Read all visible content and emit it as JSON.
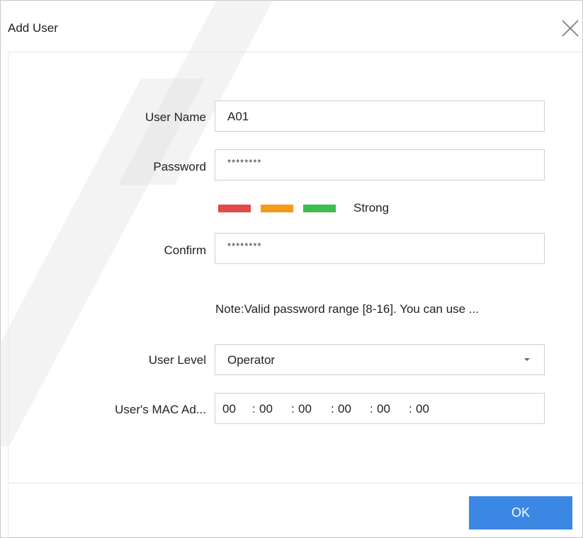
{
  "dialog": {
    "title": "Add User",
    "close_icon": "close-icon"
  },
  "form": {
    "user_name": {
      "label": "User Name",
      "value": "A01"
    },
    "password": {
      "label": "Password",
      "value": "********"
    },
    "strength": {
      "text": "Strong",
      "bars": [
        {
          "color": "#e24a4a"
        },
        {
          "color": "#f49b19"
        },
        {
          "color": "#3ebd4f"
        }
      ]
    },
    "confirm": {
      "label": "Confirm",
      "value": "********"
    },
    "note": "Note:Valid password range [8-16]. You can use ...",
    "user_level": {
      "label": "User Level",
      "value": "Operator",
      "caret_icon": "caret-down-icon"
    },
    "mac": {
      "label": "User's MAC Ad...",
      "segments": [
        "00",
        ":",
        "00",
        ":",
        "00",
        ":",
        "00",
        ":",
        "00",
        ":",
        "00"
      ]
    }
  },
  "footer": {
    "ok_label": "OK",
    "ok_color": "#3a87e4"
  }
}
